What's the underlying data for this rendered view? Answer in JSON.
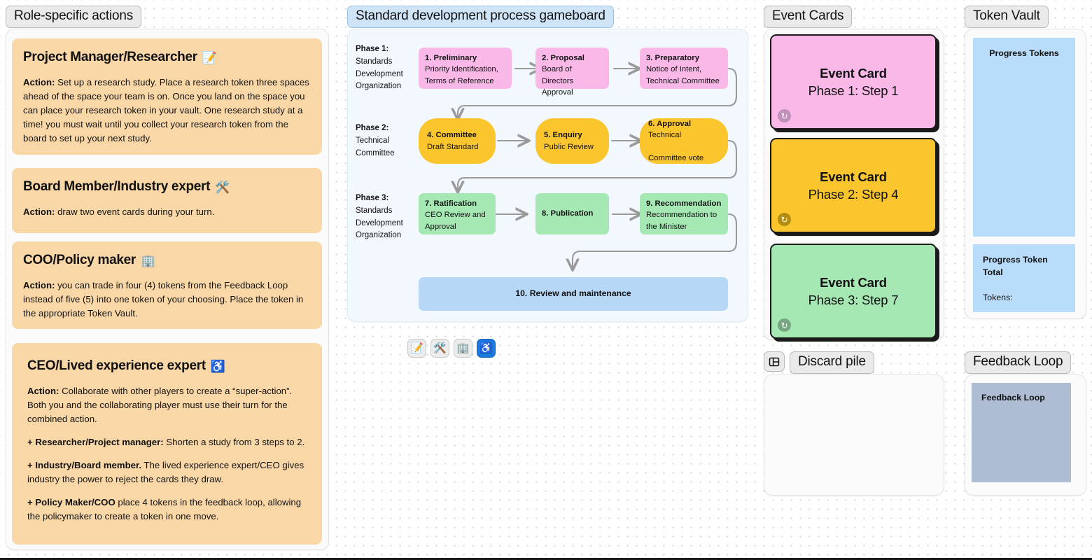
{
  "panels": {
    "roles_label": "Role-specific actions",
    "gameboard_label": "Standard development process gameboard",
    "event_cards_label": "Event Cards",
    "token_vault_label": "Token Vault",
    "discard_label": "Discard pile",
    "feedback_label": "Feedback Loop"
  },
  "roles": [
    {
      "title": "Project Manager/Researcher",
      "emoji": "📝",
      "emoji_name": "memo-icon",
      "paragraphs": [
        {
          "lead": "Action:",
          "text": " Set up a research study. Place a research token three spaces ahead of the space your team is on. Once you land on the space you can place your research token in your vault. One research study at a time! you must wait until you collect your research token from the board to set up your next study."
        }
      ]
    },
    {
      "title": "Board Member/Industry expert",
      "emoji": "🛠️",
      "emoji_name": "hammer-and-wrench-icon",
      "paragraphs": [
        {
          "lead": "Action:",
          "text": " draw two event cards during your turn."
        }
      ]
    },
    {
      "title": "COO/Policy maker",
      "emoji": "🏢",
      "emoji_name": "office-building-icon",
      "paragraphs": [
        {
          "lead": "Action:",
          "text": " you can trade in four (4) tokens from the Feedback Loop instead of five (5) into one token of your choosing. Place the token in the appropriate Token Vault."
        }
      ]
    },
    {
      "title": "CEO/Lived experience expert",
      "emoji": "♿",
      "emoji_name": "accessibility-icon",
      "paragraphs": [
        {
          "lead": "Action:",
          "text": " Collaborate with other players to create a “super-action”. Both you and the collaborating player must use their turn for the combined action."
        },
        {
          "lead": "+ Researcher/Project manager:",
          "text": " Shorten a study from 3 steps to 2."
        },
        {
          "lead": "+ Industry/Board member.",
          "text": " The lived experience expert/CEO gives industry the power to reject the cards they draw."
        },
        {
          "lead": "+ Policy Maker/COO",
          "text": " place 4 tokens in the feedback loop, allowing the policymaker to create a token in one move."
        }
      ]
    }
  ],
  "gameboard": {
    "phases": [
      {
        "name": "Phase 1:",
        "org": "Standards\nDevelopment\nOrganization",
        "org_lines": [
          "Standards",
          "Development",
          "Organization"
        ]
      },
      {
        "name": "Phase 2:",
        "org_lines": [
          "Technical",
          "Committee"
        ]
      },
      {
        "name": "Phase 3:",
        "org_lines": [
          "Standards",
          "Development",
          "Organization"
        ]
      }
    ],
    "steps": [
      {
        "id": 1,
        "head": "1. Preliminary",
        "lines": [
          "Priority Identification,",
          "Terms of Reference"
        ],
        "color": "#f9b8e8"
      },
      {
        "id": 2,
        "head": "2. Proposal",
        "lines": [
          "Board of Directors",
          "Approval"
        ],
        "color": "#f9b8e8"
      },
      {
        "id": 3,
        "head": "3. Preparatory",
        "lines": [
          "Notice of Intent,",
          "Technical Committee"
        ],
        "color": "#f9b8e8"
      },
      {
        "id": 4,
        "head": "4. Committee",
        "lines": [
          "Draft Standard"
        ],
        "color": "#fbc52d"
      },
      {
        "id": 5,
        "head": "5. Enquiry",
        "lines": [
          "Public Review"
        ],
        "color": "#fbc52d"
      },
      {
        "id": 6,
        "head": "6. Approval",
        "lines": [
          "Technical",
          "Committee vote"
        ],
        "color": "#fbc52d"
      },
      {
        "id": 7,
        "head": "7. Ratification",
        "lines": [
          "CEO Review and",
          "Approval"
        ],
        "color": "#a5e8b4"
      },
      {
        "id": 8,
        "head": "8. Publication",
        "lines": [],
        "color": "#a5e8b4"
      },
      {
        "id": 9,
        "head": "9. Recommendation",
        "lines": [
          "Recommendation to",
          "the Minister"
        ],
        "color": "#a5e8b4"
      }
    ],
    "final_step": "10. Review and maintenance",
    "player_tokens": [
      {
        "emoji": "📝",
        "name": "memo-token",
        "selected": false
      },
      {
        "emoji": "🛠️",
        "name": "hammer-and-wrench-token",
        "selected": false
      },
      {
        "emoji": "🏢",
        "name": "office-building-token",
        "selected": false
      },
      {
        "emoji": "♿",
        "name": "accessibility-token",
        "selected": true
      }
    ]
  },
  "event_cards": [
    {
      "title": "Event Card",
      "subtitle": "Phase 1: Step 1",
      "color": "#f9b8e8",
      "badge_color": "#c090b8",
      "refresh_icon": "refresh-icon"
    },
    {
      "title": "Event Card",
      "subtitle": "Phase 2: Step 4",
      "color": "#fbc52d",
      "badge_color": "#b58c12",
      "refresh_icon": "refresh-icon"
    },
    {
      "title": "Event Card",
      "subtitle": "Phase 3: Step 7",
      "color": "#a5e8b4",
      "badge_color": "#78a584",
      "refresh_icon": "refresh-icon"
    }
  ],
  "token_vault": {
    "progress_tokens_label": "Progress Tokens",
    "total_title": "Progress Token Total",
    "total_sub": "Tokens:"
  },
  "feedback_loop": {
    "box_label": "Feedback Loop"
  },
  "discard": {
    "layout_icon": "layout-frame-icon"
  },
  "colors": {
    "role_card": "#fad7a7",
    "pink": "#f9b8e8",
    "yellow": "#fbc52d",
    "green": "#a5e8b4",
    "blue": "#b7d7f7",
    "vault_blue": "#b9dcfa",
    "feedback_gray": "#aebdd3",
    "accent_selected": "#1a7ae0"
  }
}
